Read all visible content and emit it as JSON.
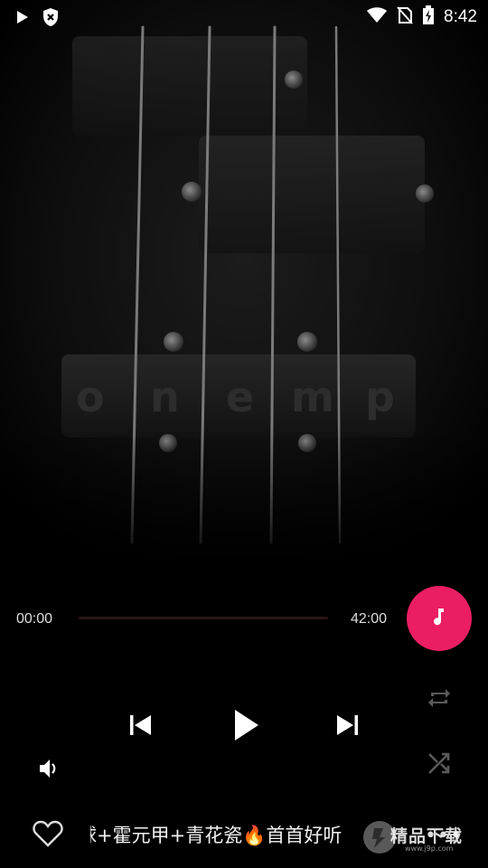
{
  "status_bar": {
    "time": "8:42",
    "icons": [
      "play-icon",
      "shield-x-icon",
      "wifi-icon",
      "no-sim-icon",
      "battery-charging-icon"
    ]
  },
  "album_art": {
    "description_icon": "bass-guitar-art",
    "pickup_letters": "onemp"
  },
  "player": {
    "current_time": "00:00",
    "total_time": "42:00",
    "progress": 0.0,
    "accent_color": "#eb1e63"
  },
  "controls": {
    "previous_icon": "skip-previous-icon",
    "play_icon": "play-icon",
    "next_icon": "skip-next-icon",
    "repeat_icon": "repeat-icon",
    "shuffle_icon": "shuffle-icon",
    "volume_icon": "volume-icon",
    "lyrics_fab_icon": "music-note-icon"
  },
  "bottom_bar": {
    "favorite_icon": "heart-outline-icon",
    "song_title": "球+霍元甲+青花瓷🔥首首好听",
    "more_label": "•••"
  },
  "watermark": {
    "text": "精品下载",
    "sub": "www.j9p.com"
  }
}
